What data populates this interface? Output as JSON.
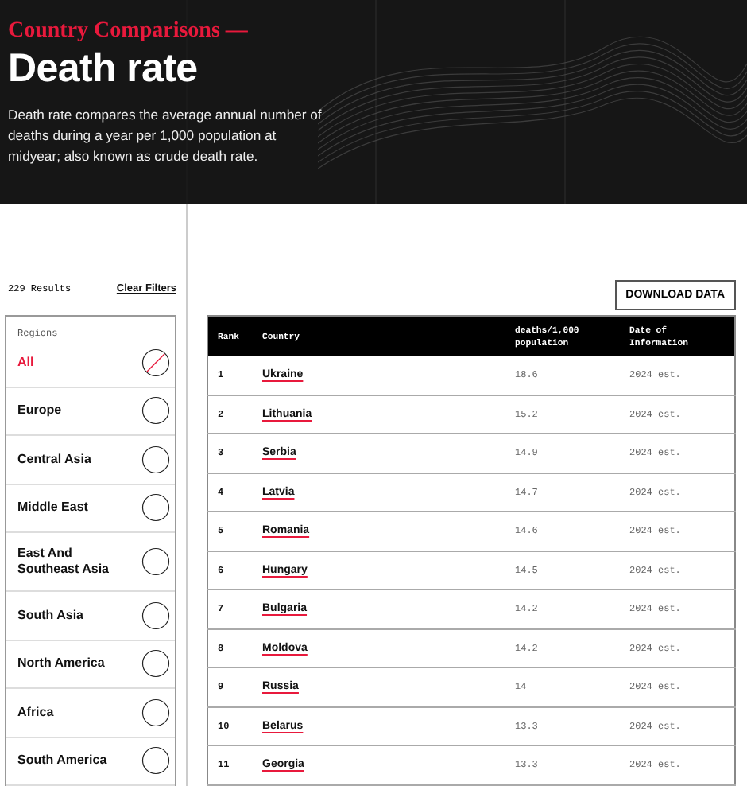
{
  "header": {
    "eyebrow": "Country Comparisons —",
    "title": "Death rate",
    "description": "Death rate compares the average annual number of deaths during a year per 1,000 population at midyear; also known as crude death rate."
  },
  "results": {
    "count": "229 Results",
    "clear": "Clear Filters"
  },
  "regions": {
    "heading": "Regions",
    "items": [
      {
        "label": "All",
        "selected": true
      },
      {
        "label": "Europe",
        "selected": false
      },
      {
        "label": "Central Asia",
        "selected": false
      },
      {
        "label": "Middle East",
        "selected": false
      },
      {
        "label": "East And Southeast Asia",
        "selected": false
      },
      {
        "label": "South Asia",
        "selected": false
      },
      {
        "label": "North America",
        "selected": false
      },
      {
        "label": "Africa",
        "selected": false
      },
      {
        "label": "South America",
        "selected": false
      }
    ]
  },
  "download_button": "DOWNLOAD DATA",
  "table": {
    "columns": [
      "Rank",
      "Country",
      "deaths/1,000 population",
      "Date of Information"
    ],
    "rows": [
      [
        "1",
        "Ukraine",
        "18.6",
        "2024 est."
      ],
      [
        "2",
        "Lithuania",
        "15.2",
        "2024 est."
      ],
      [
        "3",
        "Serbia",
        "14.9",
        "2024 est."
      ],
      [
        "4",
        "Latvia",
        "14.7",
        "2024 est."
      ],
      [
        "5",
        "Romania",
        "14.6",
        "2024 est."
      ],
      [
        "6",
        "Hungary",
        "14.5",
        "2024 est."
      ],
      [
        "7",
        "Bulgaria",
        "14.2",
        "2024 est."
      ],
      [
        "8",
        "Moldova",
        "14.2",
        "2024 est."
      ],
      [
        "9",
        "Russia",
        "14",
        "2024 est."
      ],
      [
        "10",
        "Belarus",
        "13.3",
        "2024 est."
      ],
      [
        "11",
        "Georgia",
        "13.3",
        "2024 est."
      ]
    ]
  }
}
